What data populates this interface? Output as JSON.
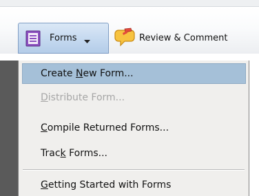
{
  "toolbar": {
    "forms_label": "Forms",
    "forms_icon": "forms-icon",
    "review_label": "Review & Comment",
    "review_icon": "speech-bubble-pencil-icon"
  },
  "menu": {
    "items": [
      {
        "before": "Create ",
        "mnemonic": "N",
        "after": "ew Form...",
        "state": "selected"
      },
      {
        "before": "",
        "mnemonic": "D",
        "after": "istribute Form...",
        "state": "disabled"
      },
      {
        "before": "",
        "mnemonic": "C",
        "after": "ompile Returned Forms...",
        "state": "normal"
      },
      {
        "before": "Trac",
        "mnemonic": "k",
        "after": " Forms...",
        "state": "normal"
      },
      {
        "before": "",
        "mnemonic": "G",
        "after": "etting Started with Forms",
        "state": "normal"
      }
    ]
  },
  "colors": {
    "selected_bg": "#a5c0d8",
    "disabled_text": "#a6a6a6",
    "forms_button_bg": "#c6daf0"
  }
}
